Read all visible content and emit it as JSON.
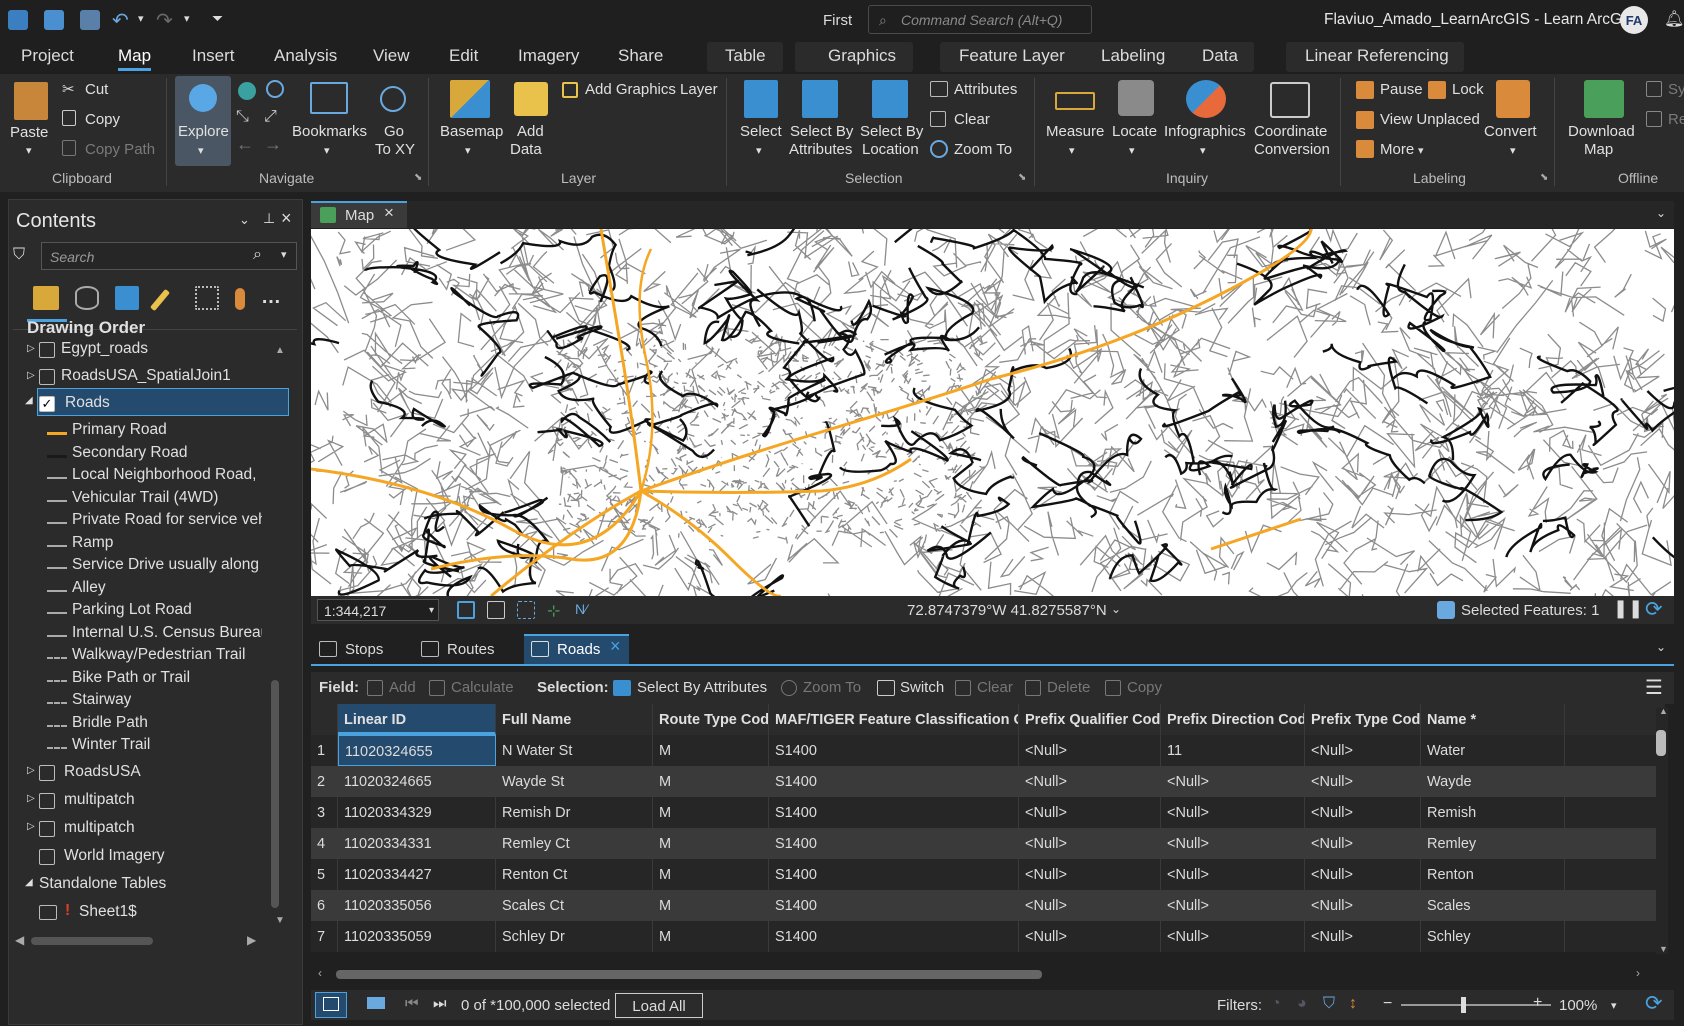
{
  "titlebar": {
    "first_label": "First",
    "command_search_placeholder": "Command Search (Alt+Q)",
    "project_title": "Flaviuo_Amado_LearnArcGIS - Learn ArcGIS",
    "user_initials": "FA"
  },
  "tabs": [
    "Project",
    "Map",
    "Insert",
    "Analysis",
    "View",
    "Edit",
    "Imagery",
    "Share"
  ],
  "context_tabs": {
    "table": "Table",
    "graphics": "Graphics",
    "feature_layer": "Feature Layer",
    "labeling": "Labeling",
    "data": "Data",
    "linear_referencing": "Linear Referencing"
  },
  "ribbon": {
    "clipboard": {
      "paste": "Paste",
      "cut": "Cut",
      "copy": "Copy",
      "copy_path": "Copy Path",
      "group": "Clipboard"
    },
    "navigate": {
      "explore": "Explore",
      "bookmarks": "Bookmarks",
      "go_to_xy_1": "Go",
      "go_to_xy_2": "To XY",
      "group": "Navigate"
    },
    "layer": {
      "basemap": "Basemap",
      "add_data_1": "Add",
      "add_data_2": "Data",
      "add_graphics_layer": "Add Graphics Layer",
      "group": "Layer"
    },
    "selection": {
      "select": "Select",
      "select_by_attr_1": "Select By",
      "select_by_attr_2": "Attributes",
      "select_by_loc_1": "Select By",
      "select_by_loc_2": "Location",
      "attributes": "Attributes",
      "clear": "Clear",
      "zoom_to": "Zoom To",
      "group": "Selection"
    },
    "inquiry": {
      "measure": "Measure",
      "locate": "Locate",
      "infographics": "Infographics",
      "coord_1": "Coordinate",
      "coord_2": "Conversion",
      "group": "Inquiry"
    },
    "labeling": {
      "pause": "Pause",
      "lock": "Lock",
      "view_unplaced": "View Unplaced",
      "more": "More",
      "convert": "Convert",
      "group": "Labeling"
    },
    "offline": {
      "download_1": "Download",
      "download_2": "Map",
      "group": "Offline",
      "sync": "Sy",
      "remove": "Re"
    }
  },
  "contents": {
    "title": "Contents",
    "search_placeholder": "Search",
    "drawing_order": "Drawing Order",
    "layers_top": [
      {
        "name": "Egypt_roads",
        "checked": false
      },
      {
        "name": "RoadsUSA_SpatialJoin1",
        "checked": false
      },
      {
        "name": "Roads",
        "checked": true
      }
    ],
    "legend": [
      "Primary Road",
      "Secondary Road",
      "Local Neighborhood Road, Rur",
      "Vehicular Trail (4WD)",
      "Private Road for service vehicle",
      "Ramp",
      "Service Drive usually along a lii",
      "Alley",
      "Parking Lot Road",
      "Internal U.S. Census Bureau use",
      "Walkway/Pedestrian Trail",
      "Bike Path or Trail",
      "Stairway",
      "Bridle Path",
      "Winter Trail"
    ],
    "layers_bottom": [
      {
        "name": "RoadsUSA"
      },
      {
        "name": "multipatch"
      },
      {
        "name": "multipatch"
      },
      {
        "name": "World Imagery"
      }
    ],
    "standalone": "Standalone Tables",
    "sheet": "Sheet1$",
    "colors": {
      "primary": "#f5a623",
      "secondary": "#1a1a1a"
    }
  },
  "map": {
    "tab": "Map",
    "scale": "1:344,217",
    "coords": "72.8747379°W 41.8275587°N",
    "selected_features": "Selected Features: 1"
  },
  "table": {
    "tabs": [
      "Stops",
      "Routes",
      "Roads"
    ],
    "toolbar": {
      "field": "Field:",
      "add": "Add",
      "calculate": "Calculate",
      "selection": "Selection:",
      "select_by_attr": "Select By Attributes",
      "zoom_to": "Zoom To",
      "switch": "Switch",
      "clear": "Clear",
      "delete": "Delete",
      "copy": "Copy"
    },
    "columns": [
      "Linear ID",
      "Full Name",
      "Route Type Code",
      "MAF/TIGER Feature Classification Code",
      "Prefix Qualifier Code",
      "Prefix Direction Code",
      "Prefix Type Code",
      "Name *"
    ],
    "rows": [
      [
        "1",
        "11020324655",
        "N Water St",
        "M",
        "S1400",
        "<Null>",
        "11",
        "<Null>",
        "Water"
      ],
      [
        "2",
        "11020324665",
        "Wayde St",
        "M",
        "S1400",
        "<Null>",
        "<Null>",
        "<Null>",
        "Wayde"
      ],
      [
        "3",
        "11020334329",
        "Remish Dr",
        "M",
        "S1400",
        "<Null>",
        "<Null>",
        "<Null>",
        "Remish"
      ],
      [
        "4",
        "11020334331",
        "Remley Ct",
        "M",
        "S1400",
        "<Null>",
        "<Null>",
        "<Null>",
        "Remley"
      ],
      [
        "5",
        "11020334427",
        "Renton Ct",
        "M",
        "S1400",
        "<Null>",
        "<Null>",
        "<Null>",
        "Renton"
      ],
      [
        "6",
        "11020335056",
        "Scales Ct",
        "M",
        "S1400",
        "<Null>",
        "<Null>",
        "<Null>",
        "Scales"
      ],
      [
        "7",
        "11020335059",
        "Schley Dr",
        "M",
        "S1400",
        "<Null>",
        "<Null>",
        "<Null>",
        "Schley"
      ]
    ],
    "selected_status": "0 of *100,000 selected",
    "load_all": "Load All",
    "filters": "Filters:",
    "zoom": "100%"
  }
}
